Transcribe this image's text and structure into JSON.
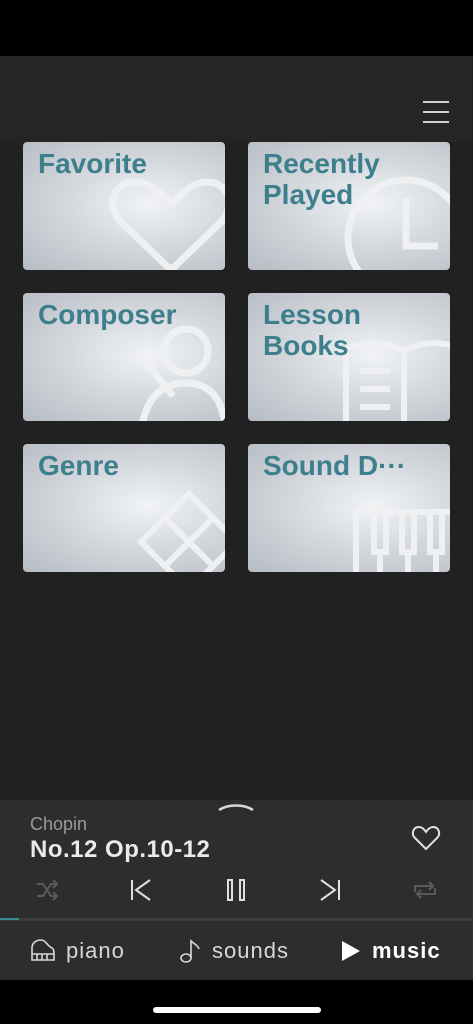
{
  "header": {
    "menu_icon": "hamburger-menu-icon"
  },
  "categories": [
    {
      "label": "Favorite",
      "icon": "heart-icon"
    },
    {
      "label": "Recently\nPlayed",
      "icon": "clock-icon"
    },
    {
      "label": "Composer",
      "icon": "person-icon"
    },
    {
      "label": "Lesson\nBooks",
      "icon": "open-book-icon"
    },
    {
      "label": "Genre",
      "icon": "diamond-grid-icon"
    },
    {
      "label": "Sound D···",
      "icon": "piano-keys-icon"
    }
  ],
  "now_playing": {
    "artist": "Chopin",
    "title": "No.12 Op.10-12",
    "progress": 0.04,
    "controls": [
      "shuffle-icon",
      "previous-track-icon",
      "pause-icon",
      "next-track-icon",
      "repeat-icon"
    ]
  },
  "tabs": [
    {
      "label": "piano",
      "icon": "grand-piano-icon",
      "active": false
    },
    {
      "label": "sounds",
      "icon": "music-note-icon",
      "active": false
    },
    {
      "label": "music",
      "icon": "play-icon",
      "active": true
    }
  ],
  "colors": {
    "accent": "#3d7f8c",
    "background": "#212121",
    "tile_light": "#eef0f2"
  }
}
